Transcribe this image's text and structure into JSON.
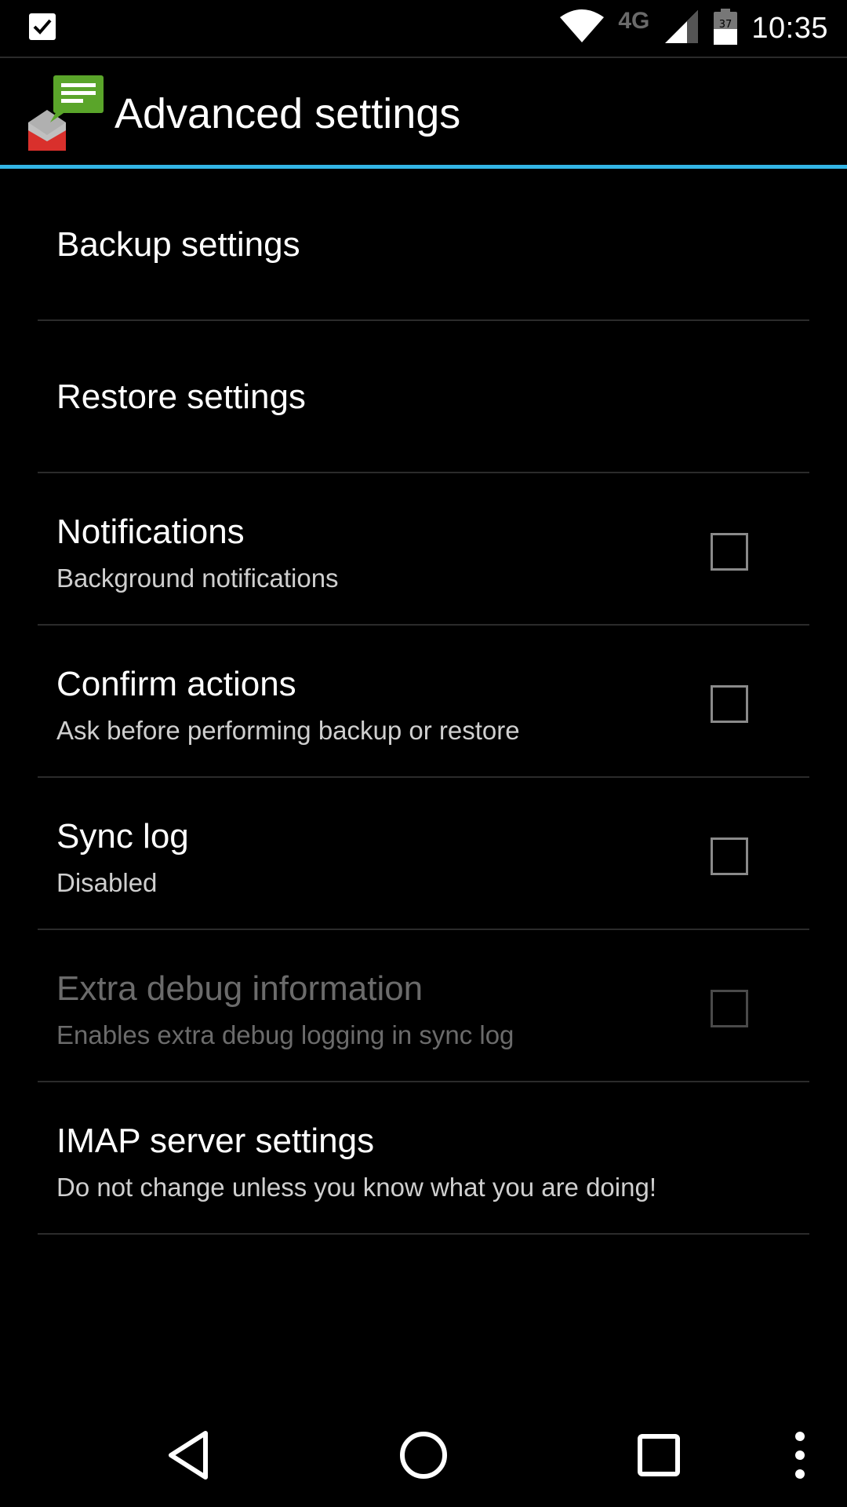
{
  "status_bar": {
    "time": "10:35",
    "network_type": "4G",
    "battery_level": "37",
    "icons": [
      "checkbox-notification-icon",
      "wifi-icon",
      "cell-signal-icon",
      "battery-icon"
    ]
  },
  "action_bar": {
    "title": "Advanced settings",
    "app_icon": "sms-backup-icon"
  },
  "settings": [
    {
      "title": "Backup settings",
      "summary": null,
      "has_checkbox": false,
      "checked": false,
      "enabled": true
    },
    {
      "title": "Restore settings",
      "summary": null,
      "has_checkbox": false,
      "checked": false,
      "enabled": true
    },
    {
      "title": "Notifications",
      "summary": "Background notifications",
      "has_checkbox": true,
      "checked": false,
      "enabled": true
    },
    {
      "title": "Confirm actions",
      "summary": "Ask before performing backup or restore",
      "has_checkbox": true,
      "checked": false,
      "enabled": true
    },
    {
      "title": "Sync log",
      "summary": "Disabled",
      "has_checkbox": true,
      "checked": false,
      "enabled": true
    },
    {
      "title": "Extra debug information",
      "summary": "Enables extra debug logging in sync log",
      "has_checkbox": true,
      "checked": false,
      "enabled": false
    },
    {
      "title": "IMAP server settings",
      "summary": "Do not change unless you know what you are doing!",
      "has_checkbox": false,
      "checked": false,
      "enabled": true
    }
  ],
  "nav_bar": {
    "icons": [
      "back-icon",
      "home-icon",
      "recents-icon",
      "overflow-menu-icon"
    ]
  },
  "colors": {
    "accent": "#33b5e5",
    "background": "#000000",
    "divider": "#2b2b2b"
  }
}
